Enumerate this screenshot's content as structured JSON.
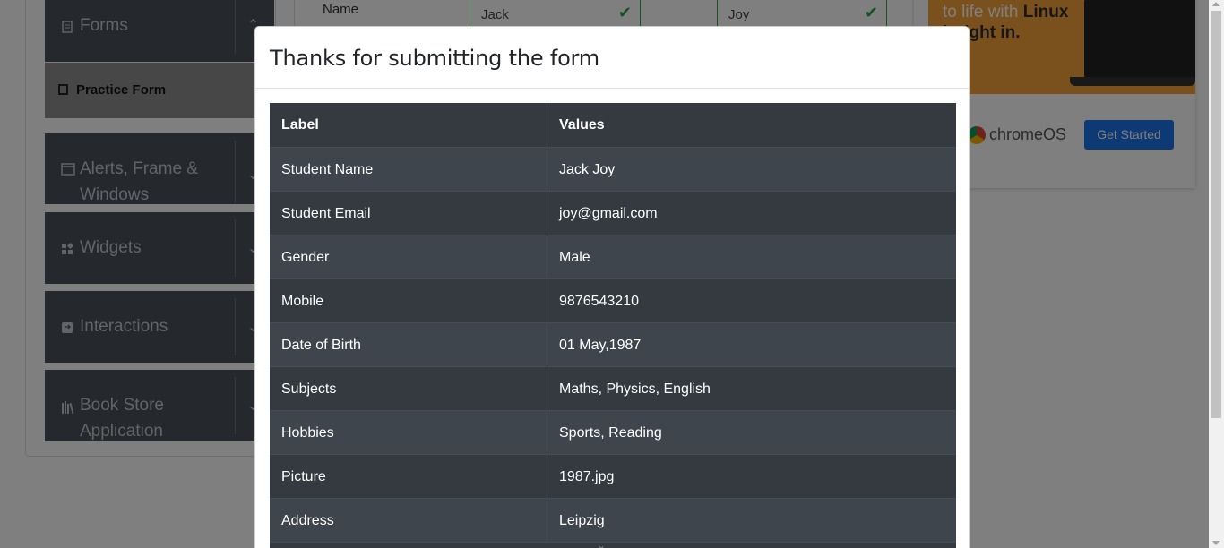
{
  "sidebar": {
    "forms_label": "Forms",
    "practice_form_label": "Practice Form",
    "alerts_label": "Alerts, Frame & Windows",
    "widgets_label": "Widgets",
    "interactions_label": "Interactions",
    "book_store_label": "Book Store Application"
  },
  "background_form": {
    "name_label": "Name",
    "first_name": "Jack",
    "last_name": "Joy"
  },
  "ad": {
    "headline_plain": "to life with ",
    "headline_bold": "Linux",
    "headline_line2": "lt right in.",
    "brand": "chromeOS",
    "cta": "Get Started"
  },
  "modal": {
    "title": "Thanks for submitting the form",
    "headers": {
      "label": "Label",
      "values": "Values"
    },
    "rows": [
      {
        "label": "Student Name",
        "value": "Jack Joy"
      },
      {
        "label": "Student Email",
        "value": "joy@gmail.com"
      },
      {
        "label": "Gender",
        "value": "Male"
      },
      {
        "label": "Mobile",
        "value": "9876543210"
      },
      {
        "label": "Date of Birth",
        "value": "01 May,1987"
      },
      {
        "label": "Subjects",
        "value": "Maths, Physics, English"
      },
      {
        "label": "Hobbies",
        "value": "Sports, Reading"
      },
      {
        "label": "Picture",
        "value": "1987.jpg"
      },
      {
        "label": "Address",
        "value": "Leipzig"
      }
    ]
  },
  "colors": {
    "table_dark": "#343a40",
    "table_stripe": "#3f454c",
    "sidebar_bg": "#4a525a",
    "success_green": "#28a745",
    "cta_blue": "#1a73e8",
    "ad_orange": "#f5a33a"
  }
}
